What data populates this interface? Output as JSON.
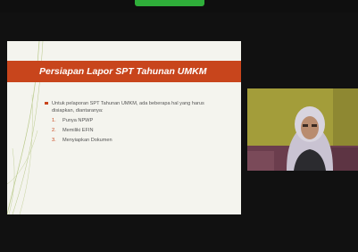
{
  "top_bar": {
    "share_caption": "",
    "extra_label": "",
    "right_label": ""
  },
  "slide": {
    "title": "Persiapan Lapor SPT Tahunan UMKM",
    "intro": "Untuk pelaporan SPT Tahunan UMKM, ada beberapa hal yang harus disiapkan, diantaranya:",
    "items": [
      {
        "num": "1.",
        "label": "Punya NPWP"
      },
      {
        "num": "2.",
        "label": "Memiliki EFIN"
      },
      {
        "num": "3.",
        "label": "Menyiapkan Dokumen"
      }
    ]
  },
  "webcam": {
    "participant_name": "",
    "background_color": "#a09a38"
  },
  "colors": {
    "accent": "#c8451c",
    "share_indicator": "#2fae3a",
    "slide_background": "#f4f4ee",
    "meeting_background": "#111111"
  }
}
